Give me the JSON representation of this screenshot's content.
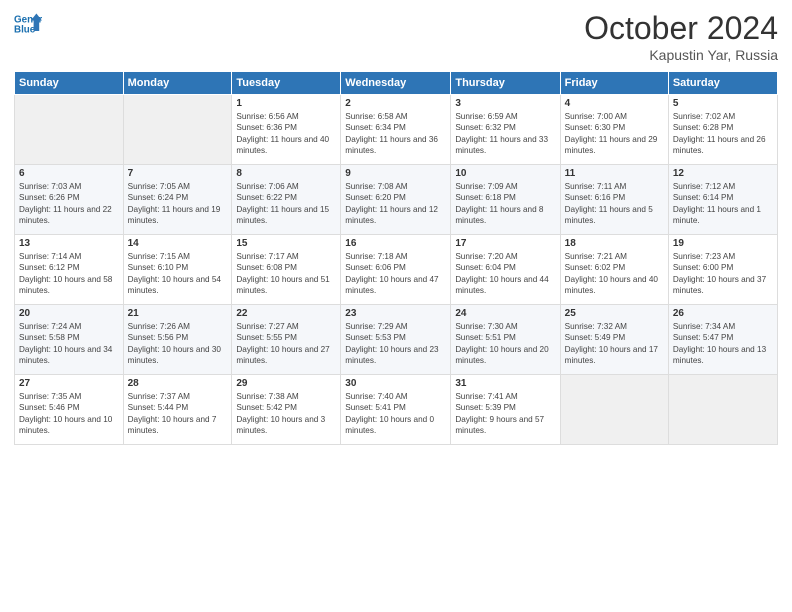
{
  "header": {
    "title": "October 2024",
    "subtitle": "Kapustin Yar, Russia"
  },
  "days": [
    "Sunday",
    "Monday",
    "Tuesday",
    "Wednesday",
    "Thursday",
    "Friday",
    "Saturday"
  ],
  "weeks": [
    [
      {
        "num": "",
        "sunrise": "",
        "sunset": "",
        "daylight": ""
      },
      {
        "num": "",
        "sunrise": "",
        "sunset": "",
        "daylight": ""
      },
      {
        "num": "1",
        "sunrise": "Sunrise: 6:56 AM",
        "sunset": "Sunset: 6:36 PM",
        "daylight": "Daylight: 11 hours and 40 minutes."
      },
      {
        "num": "2",
        "sunrise": "Sunrise: 6:58 AM",
        "sunset": "Sunset: 6:34 PM",
        "daylight": "Daylight: 11 hours and 36 minutes."
      },
      {
        "num": "3",
        "sunrise": "Sunrise: 6:59 AM",
        "sunset": "Sunset: 6:32 PM",
        "daylight": "Daylight: 11 hours and 33 minutes."
      },
      {
        "num": "4",
        "sunrise": "Sunrise: 7:00 AM",
        "sunset": "Sunset: 6:30 PM",
        "daylight": "Daylight: 11 hours and 29 minutes."
      },
      {
        "num": "5",
        "sunrise": "Sunrise: 7:02 AM",
        "sunset": "Sunset: 6:28 PM",
        "daylight": "Daylight: 11 hours and 26 minutes."
      }
    ],
    [
      {
        "num": "6",
        "sunrise": "Sunrise: 7:03 AM",
        "sunset": "Sunset: 6:26 PM",
        "daylight": "Daylight: 11 hours and 22 minutes."
      },
      {
        "num": "7",
        "sunrise": "Sunrise: 7:05 AM",
        "sunset": "Sunset: 6:24 PM",
        "daylight": "Daylight: 11 hours and 19 minutes."
      },
      {
        "num": "8",
        "sunrise": "Sunrise: 7:06 AM",
        "sunset": "Sunset: 6:22 PM",
        "daylight": "Daylight: 11 hours and 15 minutes."
      },
      {
        "num": "9",
        "sunrise": "Sunrise: 7:08 AM",
        "sunset": "Sunset: 6:20 PM",
        "daylight": "Daylight: 11 hours and 12 minutes."
      },
      {
        "num": "10",
        "sunrise": "Sunrise: 7:09 AM",
        "sunset": "Sunset: 6:18 PM",
        "daylight": "Daylight: 11 hours and 8 minutes."
      },
      {
        "num": "11",
        "sunrise": "Sunrise: 7:11 AM",
        "sunset": "Sunset: 6:16 PM",
        "daylight": "Daylight: 11 hours and 5 minutes."
      },
      {
        "num": "12",
        "sunrise": "Sunrise: 7:12 AM",
        "sunset": "Sunset: 6:14 PM",
        "daylight": "Daylight: 11 hours and 1 minute."
      }
    ],
    [
      {
        "num": "13",
        "sunrise": "Sunrise: 7:14 AM",
        "sunset": "Sunset: 6:12 PM",
        "daylight": "Daylight: 10 hours and 58 minutes."
      },
      {
        "num": "14",
        "sunrise": "Sunrise: 7:15 AM",
        "sunset": "Sunset: 6:10 PM",
        "daylight": "Daylight: 10 hours and 54 minutes."
      },
      {
        "num": "15",
        "sunrise": "Sunrise: 7:17 AM",
        "sunset": "Sunset: 6:08 PM",
        "daylight": "Daylight: 10 hours and 51 minutes."
      },
      {
        "num": "16",
        "sunrise": "Sunrise: 7:18 AM",
        "sunset": "Sunset: 6:06 PM",
        "daylight": "Daylight: 10 hours and 47 minutes."
      },
      {
        "num": "17",
        "sunrise": "Sunrise: 7:20 AM",
        "sunset": "Sunset: 6:04 PM",
        "daylight": "Daylight: 10 hours and 44 minutes."
      },
      {
        "num": "18",
        "sunrise": "Sunrise: 7:21 AM",
        "sunset": "Sunset: 6:02 PM",
        "daylight": "Daylight: 10 hours and 40 minutes."
      },
      {
        "num": "19",
        "sunrise": "Sunrise: 7:23 AM",
        "sunset": "Sunset: 6:00 PM",
        "daylight": "Daylight: 10 hours and 37 minutes."
      }
    ],
    [
      {
        "num": "20",
        "sunrise": "Sunrise: 7:24 AM",
        "sunset": "Sunset: 5:58 PM",
        "daylight": "Daylight: 10 hours and 34 minutes."
      },
      {
        "num": "21",
        "sunrise": "Sunrise: 7:26 AM",
        "sunset": "Sunset: 5:56 PM",
        "daylight": "Daylight: 10 hours and 30 minutes."
      },
      {
        "num": "22",
        "sunrise": "Sunrise: 7:27 AM",
        "sunset": "Sunset: 5:55 PM",
        "daylight": "Daylight: 10 hours and 27 minutes."
      },
      {
        "num": "23",
        "sunrise": "Sunrise: 7:29 AM",
        "sunset": "Sunset: 5:53 PM",
        "daylight": "Daylight: 10 hours and 23 minutes."
      },
      {
        "num": "24",
        "sunrise": "Sunrise: 7:30 AM",
        "sunset": "Sunset: 5:51 PM",
        "daylight": "Daylight: 10 hours and 20 minutes."
      },
      {
        "num": "25",
        "sunrise": "Sunrise: 7:32 AM",
        "sunset": "Sunset: 5:49 PM",
        "daylight": "Daylight: 10 hours and 17 minutes."
      },
      {
        "num": "26",
        "sunrise": "Sunrise: 7:34 AM",
        "sunset": "Sunset: 5:47 PM",
        "daylight": "Daylight: 10 hours and 13 minutes."
      }
    ],
    [
      {
        "num": "27",
        "sunrise": "Sunrise: 7:35 AM",
        "sunset": "Sunset: 5:46 PM",
        "daylight": "Daylight: 10 hours and 10 minutes."
      },
      {
        "num": "28",
        "sunrise": "Sunrise: 7:37 AM",
        "sunset": "Sunset: 5:44 PM",
        "daylight": "Daylight: 10 hours and 7 minutes."
      },
      {
        "num": "29",
        "sunrise": "Sunrise: 7:38 AM",
        "sunset": "Sunset: 5:42 PM",
        "daylight": "Daylight: 10 hours and 3 minutes."
      },
      {
        "num": "30",
        "sunrise": "Sunrise: 7:40 AM",
        "sunset": "Sunset: 5:41 PM",
        "daylight": "Daylight: 10 hours and 0 minutes."
      },
      {
        "num": "31",
        "sunrise": "Sunrise: 7:41 AM",
        "sunset": "Sunset: 5:39 PM",
        "daylight": "Daylight: 9 hours and 57 minutes."
      },
      {
        "num": "",
        "sunrise": "",
        "sunset": "",
        "daylight": ""
      },
      {
        "num": "",
        "sunrise": "",
        "sunset": "",
        "daylight": ""
      }
    ]
  ]
}
